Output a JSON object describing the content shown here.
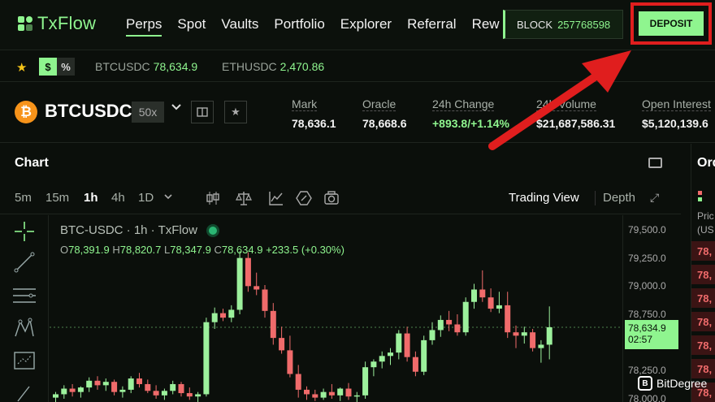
{
  "app": {
    "name": "TxFlow",
    "brand_color": "#8ff58f",
    "accent_down": "#f06b6b"
  },
  "nav": {
    "items": [
      {
        "label": "Perps",
        "active": true
      },
      {
        "label": "Spot"
      },
      {
        "label": "Vaults"
      },
      {
        "label": "Portfolio"
      },
      {
        "label": "Explorer"
      },
      {
        "label": "Referral"
      },
      {
        "label": "Rew"
      }
    ],
    "block_label": "BLOCK",
    "block_value": "257768598",
    "deposit_label": "DEPOSIT"
  },
  "ticker": {
    "toggle_dollar": "$",
    "toggle_percent": "%",
    "items": [
      {
        "symbol": "BTCUSDC",
        "price": "78,634.9"
      },
      {
        "symbol": "ETHUSDC",
        "price": "2,470.86"
      }
    ]
  },
  "market": {
    "pair": "BTCUSDC",
    "coin_icon": "bitcoin-icon",
    "leverage": "50x",
    "stats": [
      {
        "label": "Mark",
        "value": "78,636.1"
      },
      {
        "label": "Oracle",
        "value": "78,668.6"
      },
      {
        "label": "24h Change",
        "value": "+893.8/+1.14%",
        "positive": true
      },
      {
        "label": "24h Volume",
        "value": "$21,687,586.31"
      },
      {
        "label": "Open Interest",
        "value": "$5,120,139.6"
      }
    ]
  },
  "chart_panel": {
    "title": "Chart",
    "timeframes": [
      "5m",
      "15m",
      "1h",
      "4h",
      "1D"
    ],
    "active_timeframe": "1h",
    "view_trading": "Trading View",
    "view_depth": "Depth",
    "legend_title": "BTC-USDC · 1h · TxFlow",
    "ohlc": {
      "o_label": "O",
      "o": "78,391.9",
      "h_label": "H",
      "h": "78,820.7",
      "l_label": "L",
      "l": "78,347.9",
      "c_label": "C",
      "c": "78,634.9",
      "change": "+233.5 (+0.30%)"
    },
    "last_price": "78,634.9",
    "countdown": "02:57"
  },
  "order_book": {
    "title": "Ord",
    "col_label_1": "Pric",
    "col_label_2": "(US",
    "rows": [
      "78,",
      "78,",
      "78,",
      "78,",
      "78,",
      "78,",
      "78,"
    ]
  },
  "watermark": {
    "text": "BitDegree",
    "badge": "B"
  },
  "chart_data": {
    "type": "candlestick",
    "title": "BTC-USDC · 1h · TxFlow",
    "ylim": [
      77950,
      79600
    ],
    "y_ticks": [
      "79,500.0",
      "79,250.0",
      "79,000.0",
      "78,750.0",
      "78,250.0",
      "78,000.0"
    ],
    "candles": [
      {
        "o": 78010,
        "h": 78060,
        "l": 77950,
        "c": 78040
      },
      {
        "o": 78040,
        "h": 78120,
        "l": 78000,
        "c": 78090
      },
      {
        "o": 78090,
        "h": 78130,
        "l": 78020,
        "c": 78060
      },
      {
        "o": 78060,
        "h": 78110,
        "l": 78010,
        "c": 78100
      },
      {
        "o": 78100,
        "h": 78190,
        "l": 78060,
        "c": 78160
      },
      {
        "o": 78160,
        "h": 78200,
        "l": 78080,
        "c": 78120
      },
      {
        "o": 78120,
        "h": 78180,
        "l": 78070,
        "c": 78150
      },
      {
        "o": 78150,
        "h": 78170,
        "l": 78030,
        "c": 78060
      },
      {
        "o": 78060,
        "h": 78110,
        "l": 78010,
        "c": 78080
      },
      {
        "o": 78080,
        "h": 78200,
        "l": 78050,
        "c": 78180
      },
      {
        "o": 78180,
        "h": 78230,
        "l": 78100,
        "c": 78130
      },
      {
        "o": 78130,
        "h": 78170,
        "l": 78050,
        "c": 78070
      },
      {
        "o": 78070,
        "h": 78120,
        "l": 78000,
        "c": 78030
      },
      {
        "o": 78030,
        "h": 78090,
        "l": 77990,
        "c": 78070
      },
      {
        "o": 78070,
        "h": 78160,
        "l": 78040,
        "c": 78130
      },
      {
        "o": 78130,
        "h": 78150,
        "l": 78020,
        "c": 78050
      },
      {
        "o": 78050,
        "h": 78100,
        "l": 77990,
        "c": 78020
      },
      {
        "o": 78020,
        "h": 78060,
        "l": 77970,
        "c": 78040
      },
      {
        "o": 78040,
        "h": 78720,
        "l": 78020,
        "c": 78680
      },
      {
        "o": 78680,
        "h": 78810,
        "l": 78620,
        "c": 78760
      },
      {
        "o": 78760,
        "h": 78800,
        "l": 78690,
        "c": 78720
      },
      {
        "o": 78720,
        "h": 78830,
        "l": 78680,
        "c": 78790
      },
      {
        "o": 78790,
        "h": 79310,
        "l": 78750,
        "c": 79250
      },
      {
        "o": 79250,
        "h": 79300,
        "l": 78950,
        "c": 79000
      },
      {
        "o": 79000,
        "h": 79120,
        "l": 78920,
        "c": 78970
      },
      {
        "o": 78970,
        "h": 79010,
        "l": 78720,
        "c": 78780
      },
      {
        "o": 78780,
        "h": 78850,
        "l": 78480,
        "c": 78540
      },
      {
        "o": 78540,
        "h": 78640,
        "l": 78400,
        "c": 78430
      },
      {
        "o": 78430,
        "h": 78560,
        "l": 78190,
        "c": 78220
      },
      {
        "o": 78220,
        "h": 78300,
        "l": 78010,
        "c": 78080
      },
      {
        "o": 78080,
        "h": 78110,
        "l": 77990,
        "c": 78040
      },
      {
        "o": 78040,
        "h": 78080,
        "l": 77980,
        "c": 78010
      },
      {
        "o": 78010,
        "h": 78090,
        "l": 77990,
        "c": 78060
      },
      {
        "o": 78060,
        "h": 78130,
        "l": 78000,
        "c": 78030
      },
      {
        "o": 78030,
        "h": 78100,
        "l": 77980,
        "c": 78090
      },
      {
        "o": 78090,
        "h": 78140,
        "l": 77990,
        "c": 78020
      },
      {
        "o": 78020,
        "h": 78060,
        "l": 77970,
        "c": 78030
      },
      {
        "o": 78030,
        "h": 78330,
        "l": 78000,
        "c": 78280
      },
      {
        "o": 78280,
        "h": 78350,
        "l": 78200,
        "c": 78330
      },
      {
        "o": 78330,
        "h": 78420,
        "l": 78270,
        "c": 78380
      },
      {
        "o": 78380,
        "h": 78450,
        "l": 78300,
        "c": 78410
      },
      {
        "o": 78410,
        "h": 78610,
        "l": 78350,
        "c": 78580
      },
      {
        "o": 78580,
        "h": 78640,
        "l": 78330,
        "c": 78370
      },
      {
        "o": 78370,
        "h": 78420,
        "l": 78200,
        "c": 78240
      },
      {
        "o": 78240,
        "h": 78560,
        "l": 78210,
        "c": 78520
      },
      {
        "o": 78520,
        "h": 78680,
        "l": 78480,
        "c": 78610
      },
      {
        "o": 78610,
        "h": 78740,
        "l": 78550,
        "c": 78700
      },
      {
        "o": 78700,
        "h": 78780,
        "l": 78600,
        "c": 78660
      },
      {
        "o": 78660,
        "h": 78750,
        "l": 78560,
        "c": 78590
      },
      {
        "o": 78590,
        "h": 78900,
        "l": 78560,
        "c": 78860
      },
      {
        "o": 78860,
        "h": 79020,
        "l": 78800,
        "c": 78970
      },
      {
        "o": 78970,
        "h": 79140,
        "l": 78860,
        "c": 78900
      },
      {
        "o": 78900,
        "h": 78980,
        "l": 78770,
        "c": 78800
      },
      {
        "o": 78800,
        "h": 78950,
        "l": 78760,
        "c": 78830
      },
      {
        "o": 78830,
        "h": 78950,
        "l": 78540,
        "c": 78590
      },
      {
        "o": 78590,
        "h": 78650,
        "l": 78450,
        "c": 78560
      },
      {
        "o": 78560,
        "h": 78640,
        "l": 78490,
        "c": 78590
      },
      {
        "o": 78590,
        "h": 78620,
        "l": 78420,
        "c": 78450
      },
      {
        "o": 78450,
        "h": 78520,
        "l": 78320,
        "c": 78480
      },
      {
        "o": 78480,
        "h": 78820,
        "l": 78350,
        "c": 78635
      }
    ]
  }
}
